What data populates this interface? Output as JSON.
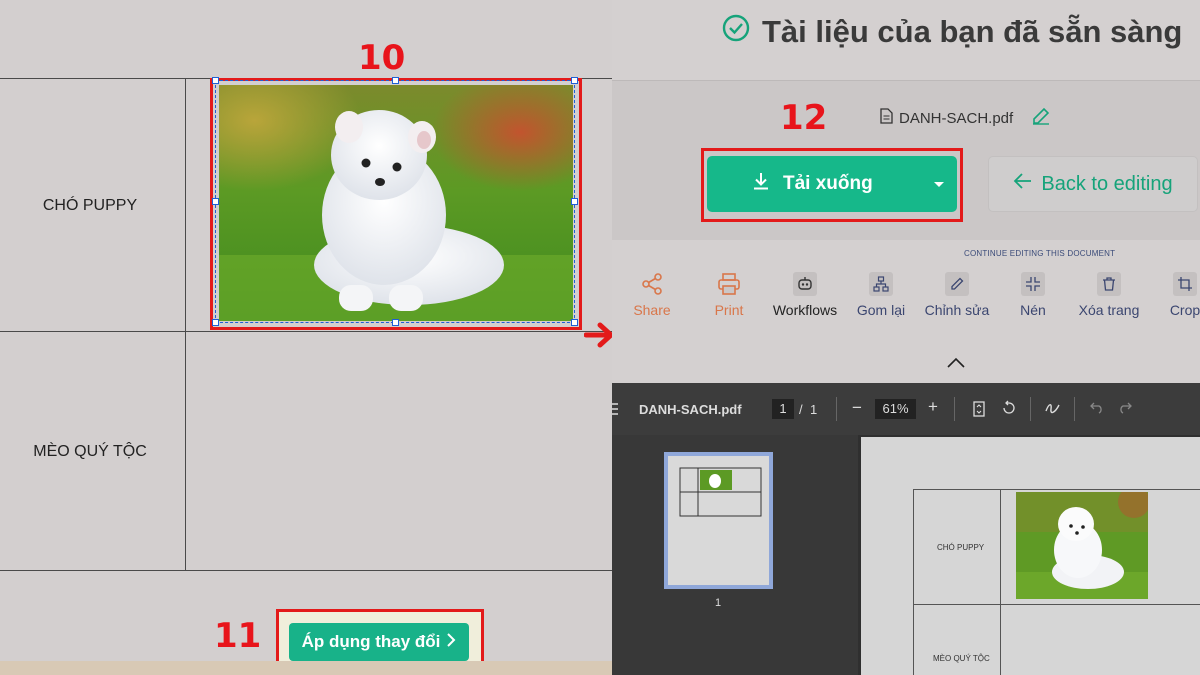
{
  "left": {
    "rows": [
      {
        "label": "CHÓ PUPPY"
      },
      {
        "label": "MÈO QUÝ TỘC"
      }
    ],
    "step_labels": {
      "image_step": "10",
      "apply_step": "11"
    },
    "apply_button": {
      "label": "Áp dụng thay đổi",
      "icon": "chevron-right-icon"
    }
  },
  "right": {
    "ready_title": "Tài liệu của bạn đã sẵn sàng",
    "step_label": "12",
    "file": {
      "name": "DANH-SACH.pdf"
    },
    "download_button": {
      "label": "Tải xuống"
    },
    "back_button": {
      "label": "Back to editing"
    },
    "continue_text": "CONTINUE EDITING THIS DOCUMENT",
    "tools": [
      {
        "label": "Share",
        "icon": "share-icon",
        "color": "#d9764a"
      },
      {
        "label": "Print",
        "icon": "printer-icon",
        "color": "#d9764a"
      },
      {
        "label": "Workflows",
        "icon": "robot-icon",
        "color": "#222222"
      },
      {
        "label": "Gom lại",
        "icon": "merge-icon",
        "color": "#3b4670"
      },
      {
        "label": "Chỉnh sửa",
        "icon": "pencil-icon",
        "color": "#3b4670"
      },
      {
        "label": "Nén",
        "icon": "compress-icon",
        "color": "#3b4670"
      },
      {
        "label": "Xóa trang",
        "icon": "trash-icon",
        "color": "#3b4670"
      },
      {
        "label": "Crop",
        "icon": "crop-icon",
        "color": "#3b4670"
      }
    ],
    "viewer": {
      "filename": "DANH-SACH.pdf",
      "page_current": "1",
      "page_sep": "/",
      "page_total": "1",
      "zoom": "61%",
      "thumb_page_number": "1",
      "page_labels": {
        "row1": "CHÓ PUPPY",
        "row2": "MÈO QUÝ TỘC"
      }
    }
  },
  "colors": {
    "accent_green": "#16b88a",
    "highlight_red": "#e31a1a"
  }
}
